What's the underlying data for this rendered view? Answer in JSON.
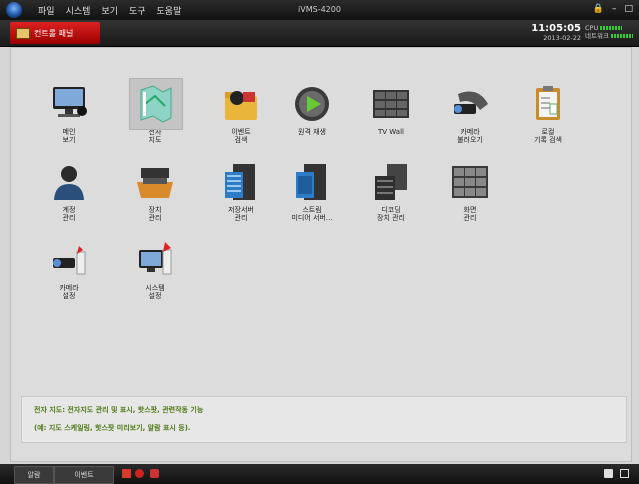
{
  "titlebar": {
    "menus": [
      "파일",
      "시스템",
      "보기",
      "도구",
      "도움말"
    ],
    "title": "iVMS-4200",
    "controls": [
      "🔒",
      "–",
      "□"
    ]
  },
  "toolbar": {
    "active_tab": "컨트롤 패널",
    "time": "11:05:05",
    "date": "2013-02-22",
    "cpu_label": "CPU",
    "net_label": "네트워크"
  },
  "tiles": [
    {
      "label": "메인\n보기",
      "icon": "monitor-icon"
    },
    {
      "label": "전자\n지도",
      "icon": "emap-icon",
      "selected": true
    },
    {
      "label": "이벤트\n검색",
      "icon": "event-folder-icon"
    },
    {
      "label": "원격 재생",
      "icon": "playback-icon"
    },
    {
      "label": "TV Wall",
      "icon": "tv-wall-icon"
    },
    {
      "label": "카메라\n불러오기",
      "icon": "camera-film-icon"
    },
    {
      "label": "로컬\n기록 검색",
      "icon": "log-clipboard-icon"
    },
    {
      "label": "계정\n관리",
      "icon": "user-icon"
    },
    {
      "label": "장치\n관리",
      "icon": "device-tray-icon"
    },
    {
      "label": "저장서버\n관리",
      "icon": "storage-server-icon"
    },
    {
      "label": "스트림\n미디어 서버...",
      "icon": "stream-server-icon"
    },
    {
      "label": "디코딩\n장치 관리",
      "icon": "decoder-icon"
    },
    {
      "label": "화면\n관리",
      "icon": "grid-icon"
    },
    {
      "label": "카메라\n설정",
      "icon": "camera-settings-icon"
    },
    {
      "label": "시스템\n설정",
      "icon": "system-settings-icon"
    }
  ],
  "description": {
    "line1": "전자 지도: 전자지도 관리 및 표시, 핫스팟, 관련작동 기능",
    "line2": "(예: 지도 스케일링, 핫스팟 미리보기, 알람 표시 등)."
  },
  "bottombar": {
    "tab1": "알람",
    "tab2": "이벤트"
  }
}
